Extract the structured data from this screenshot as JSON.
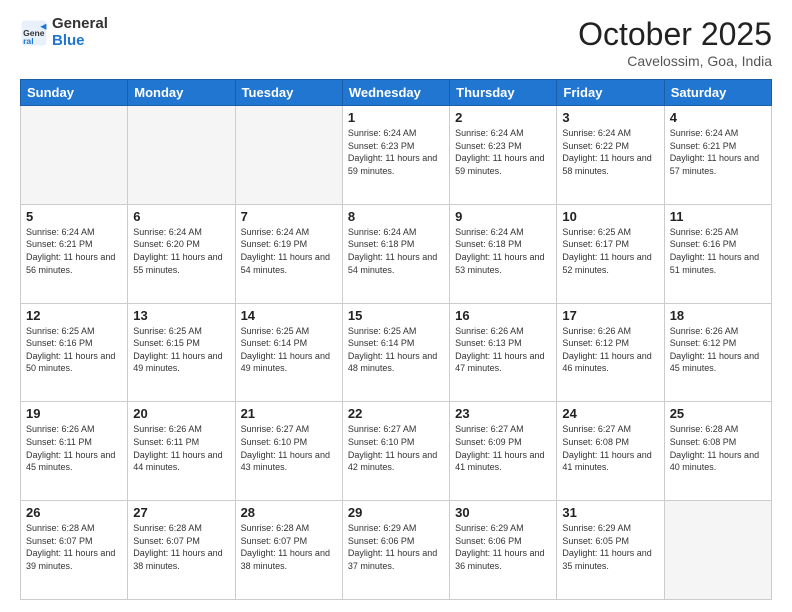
{
  "header": {
    "logo_general": "General",
    "logo_blue": "Blue",
    "month": "October 2025",
    "location": "Cavelossim, Goa, India"
  },
  "days_of_week": [
    "Sunday",
    "Monday",
    "Tuesday",
    "Wednesday",
    "Thursday",
    "Friday",
    "Saturday"
  ],
  "weeks": [
    [
      {
        "day": "",
        "empty": true
      },
      {
        "day": "",
        "empty": true
      },
      {
        "day": "",
        "empty": true
      },
      {
        "day": "1",
        "sunrise": "6:24 AM",
        "sunset": "6:23 PM",
        "daylight": "11 hours and 59 minutes."
      },
      {
        "day": "2",
        "sunrise": "6:24 AM",
        "sunset": "6:23 PM",
        "daylight": "11 hours and 59 minutes."
      },
      {
        "day": "3",
        "sunrise": "6:24 AM",
        "sunset": "6:22 PM",
        "daylight": "11 hours and 58 minutes."
      },
      {
        "day": "4",
        "sunrise": "6:24 AM",
        "sunset": "6:21 PM",
        "daylight": "11 hours and 57 minutes."
      }
    ],
    [
      {
        "day": "5",
        "sunrise": "6:24 AM",
        "sunset": "6:21 PM",
        "daylight": "11 hours and 56 minutes."
      },
      {
        "day": "6",
        "sunrise": "6:24 AM",
        "sunset": "6:20 PM",
        "daylight": "11 hours and 55 minutes."
      },
      {
        "day": "7",
        "sunrise": "6:24 AM",
        "sunset": "6:19 PM",
        "daylight": "11 hours and 54 minutes."
      },
      {
        "day": "8",
        "sunrise": "6:24 AM",
        "sunset": "6:18 PM",
        "daylight": "11 hours and 54 minutes."
      },
      {
        "day": "9",
        "sunrise": "6:24 AM",
        "sunset": "6:18 PM",
        "daylight": "11 hours and 53 minutes."
      },
      {
        "day": "10",
        "sunrise": "6:25 AM",
        "sunset": "6:17 PM",
        "daylight": "11 hours and 52 minutes."
      },
      {
        "day": "11",
        "sunrise": "6:25 AM",
        "sunset": "6:16 PM",
        "daylight": "11 hours and 51 minutes."
      }
    ],
    [
      {
        "day": "12",
        "sunrise": "6:25 AM",
        "sunset": "6:16 PM",
        "daylight": "11 hours and 50 minutes."
      },
      {
        "day": "13",
        "sunrise": "6:25 AM",
        "sunset": "6:15 PM",
        "daylight": "11 hours and 49 minutes."
      },
      {
        "day": "14",
        "sunrise": "6:25 AM",
        "sunset": "6:14 PM",
        "daylight": "11 hours and 49 minutes."
      },
      {
        "day": "15",
        "sunrise": "6:25 AM",
        "sunset": "6:14 PM",
        "daylight": "11 hours and 48 minutes."
      },
      {
        "day": "16",
        "sunrise": "6:26 AM",
        "sunset": "6:13 PM",
        "daylight": "11 hours and 47 minutes."
      },
      {
        "day": "17",
        "sunrise": "6:26 AM",
        "sunset": "6:12 PM",
        "daylight": "11 hours and 46 minutes."
      },
      {
        "day": "18",
        "sunrise": "6:26 AM",
        "sunset": "6:12 PM",
        "daylight": "11 hours and 45 minutes."
      }
    ],
    [
      {
        "day": "19",
        "sunrise": "6:26 AM",
        "sunset": "6:11 PM",
        "daylight": "11 hours and 45 minutes."
      },
      {
        "day": "20",
        "sunrise": "6:26 AM",
        "sunset": "6:11 PM",
        "daylight": "11 hours and 44 minutes."
      },
      {
        "day": "21",
        "sunrise": "6:27 AM",
        "sunset": "6:10 PM",
        "daylight": "11 hours and 43 minutes."
      },
      {
        "day": "22",
        "sunrise": "6:27 AM",
        "sunset": "6:10 PM",
        "daylight": "11 hours and 42 minutes."
      },
      {
        "day": "23",
        "sunrise": "6:27 AM",
        "sunset": "6:09 PM",
        "daylight": "11 hours and 41 minutes."
      },
      {
        "day": "24",
        "sunrise": "6:27 AM",
        "sunset": "6:08 PM",
        "daylight": "11 hours and 41 minutes."
      },
      {
        "day": "25",
        "sunrise": "6:28 AM",
        "sunset": "6:08 PM",
        "daylight": "11 hours and 40 minutes."
      }
    ],
    [
      {
        "day": "26",
        "sunrise": "6:28 AM",
        "sunset": "6:07 PM",
        "daylight": "11 hours and 39 minutes."
      },
      {
        "day": "27",
        "sunrise": "6:28 AM",
        "sunset": "6:07 PM",
        "daylight": "11 hours and 38 minutes."
      },
      {
        "day": "28",
        "sunrise": "6:28 AM",
        "sunset": "6:07 PM",
        "daylight": "11 hours and 38 minutes."
      },
      {
        "day": "29",
        "sunrise": "6:29 AM",
        "sunset": "6:06 PM",
        "daylight": "11 hours and 37 minutes."
      },
      {
        "day": "30",
        "sunrise": "6:29 AM",
        "sunset": "6:06 PM",
        "daylight": "11 hours and 36 minutes."
      },
      {
        "day": "31",
        "sunrise": "6:29 AM",
        "sunset": "6:05 PM",
        "daylight": "11 hours and 35 minutes."
      },
      {
        "day": "",
        "empty": true
      }
    ]
  ]
}
